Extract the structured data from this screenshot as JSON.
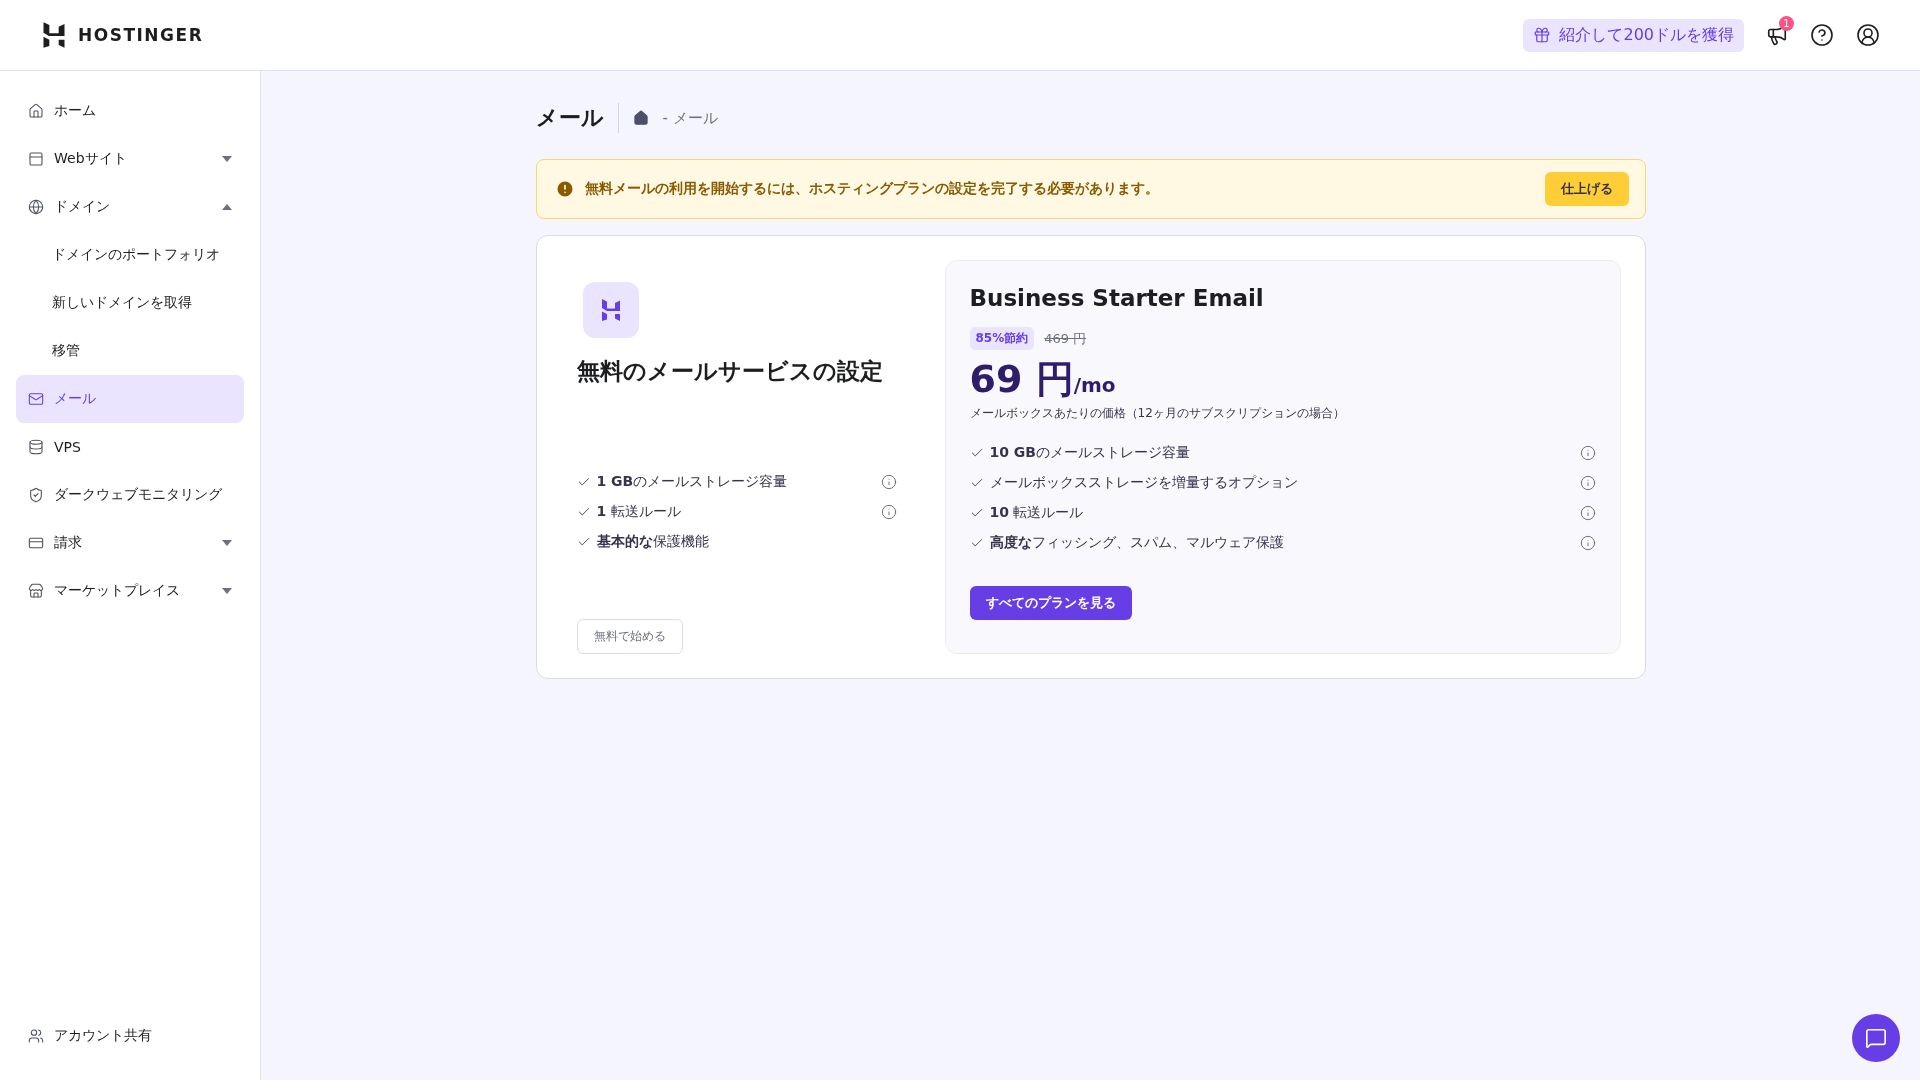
{
  "header": {
    "logo": "HOSTINGER",
    "referral": "紹介して200ドルを獲得",
    "notification_count": "1"
  },
  "sidebar": {
    "items": [
      {
        "label": "ホーム",
        "selected": false
      },
      {
        "label": "Webサイト",
        "selected": false,
        "expanded": false
      },
      {
        "label": "ドメイン",
        "selected": false,
        "expanded": true,
        "children": [
          {
            "label": "ドメインのポートフォリオ",
            "selected": false
          },
          {
            "label": "新しいドメインを取得",
            "selected": false
          },
          {
            "label": "移管",
            "selected": false
          }
        ]
      },
      {
        "label": "メール",
        "selected": true
      },
      {
        "label": "VPS",
        "selected": false
      },
      {
        "label": "ダークウェブモニタリング",
        "selected": false
      },
      {
        "label": "請求",
        "selected": false,
        "expanded": false
      },
      {
        "label": "マーケットプレイス",
        "selected": false,
        "expanded": false
      }
    ],
    "footer": {
      "label": "アカウント共有"
    }
  },
  "page": {
    "title": "メール",
    "breadcrumb": "- メール"
  },
  "alert": {
    "text": "無料メールの利用を開始するには、ホスティングプランの設定を完了する必要があります。",
    "button": "仕上げる"
  },
  "free_plan": {
    "title": "無料のメールサービスの設定",
    "features": [
      {
        "text": "**1 GB**のメールストレージ容量",
        "info": true
      },
      {
        "text": "**1** 転送ルール",
        "info": true
      },
      {
        "text": "**基本的な**保護機能",
        "info": false
      }
    ],
    "button": "無料で始める"
  },
  "paid_plan": {
    "title": "Business Starter Email",
    "discount": "85%節約",
    "old_price": "469 円",
    "price": "69 円",
    "period": "/mo",
    "note": "メールボックスあたりの価格（12ヶ月のサブスクリプションの場合）",
    "features": [
      {
        "text": "**10 GB**のメールストレージ容量",
        "info": true
      },
      {
        "text": "メールボックスストレージを増量するオプション",
        "info": true
      },
      {
        "text": "**10** 転送ルール",
        "info": true
      },
      {
        "text": "**高度な**フィッシング、スパム、マルウェア保護",
        "info": true
      }
    ],
    "button": "すべてのプランを見る"
  }
}
